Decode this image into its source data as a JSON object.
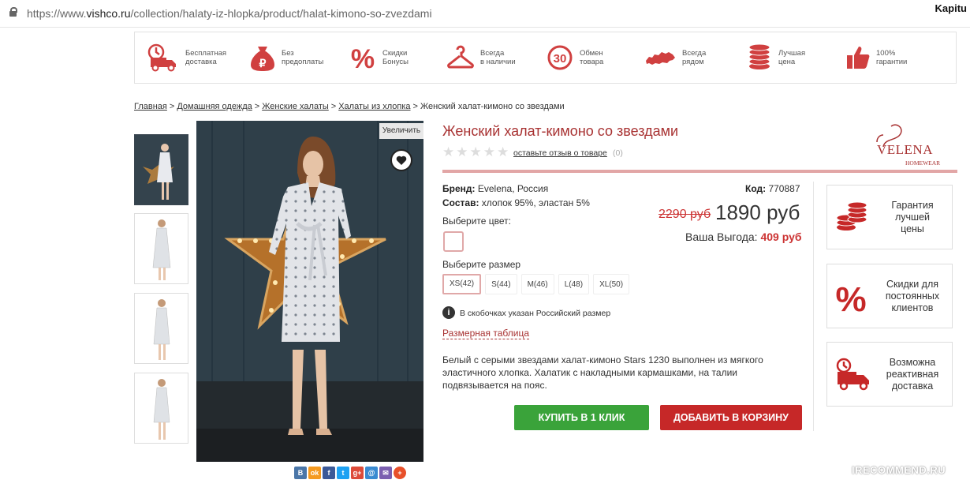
{
  "browser": {
    "url_prefix": "https://www.",
    "url_domain": "vishco.ru",
    "url_path": "/collection/halaty-iz-hlopka/product/halat-kimono-so-zvezdami",
    "top_right": "Kapitu"
  },
  "benefits": [
    {
      "icon": "delivery-truck-icon",
      "text": "Бесплатная\nдоставка"
    },
    {
      "icon": "money-bag-icon",
      "text": "Без\nпредоплаты"
    },
    {
      "icon": "percent-icon",
      "text": "Скидки\nБонусы"
    },
    {
      "icon": "hanger-icon",
      "text": "Всегда\nв наличии"
    },
    {
      "icon": "exchange-30-icon",
      "text": "Обмен\nтовара"
    },
    {
      "icon": "russia-map-icon",
      "text": "Всегда\nрядом"
    },
    {
      "icon": "coins-icon",
      "text": "Лучшая\nцена"
    },
    {
      "icon": "thumbs-up-icon",
      "text": "100%\nгарантии"
    }
  ],
  "breadcrumbs": {
    "items": [
      "Главная",
      "Домашняя одежда",
      "Женские халаты",
      "Халаты из хлопка"
    ],
    "current": "Женский халат-кимоно со звездами",
    "separator": ">"
  },
  "gallery": {
    "zoom_label": "Увеличить"
  },
  "product": {
    "title": "Женский халат-кимоно со звездами",
    "rating": 0,
    "review_link": "оставьте отзыв о товаре",
    "review_count": "(0)",
    "brand_label": "Бренд:",
    "brand_value": "Evelena, Россия",
    "composition_label": "Состав:",
    "composition_value": "хлопок 95%, эластан 5%",
    "code_label": "Код:",
    "code_value": "770887",
    "old_price": "2290 руб",
    "price": "1890 руб",
    "profit_label": "Ваша Выгода:",
    "profit_value": "409 руб",
    "color_label": "Выберите цвет:",
    "size_label": "Выберите размер",
    "sizes": [
      "XS(42)",
      "S(44)",
      "M(46)",
      "L(48)",
      "XL(50)"
    ],
    "selected_size": "XS(42)",
    "size_note": "В скобочках указан Российский размер",
    "size_table_link": "Размерная таблица",
    "description": "Белый с серыми звездами халат-кимоно Stars 1230 выполнен из мягкого эластичного хлопка. Халатик с накладными кармашками, на талии подвязывается на пояс.",
    "buy_one_click": "КУПИТЬ В 1 КЛИК",
    "add_to_cart": "ДОБАВИТЬ В КОРЗИНУ"
  },
  "brand_logo": {
    "name": "VELENA",
    "sub": "HOMEWEAR"
  },
  "side_boxes": [
    {
      "icon": "coins-icon",
      "text": "Гарантия\nлучшей\nцены"
    },
    {
      "icon": "percent-icon",
      "text": "Скидки для\nпостоянных\nклиентов"
    },
    {
      "icon": "delivery-truck-icon",
      "text": "Возможна\nреактивная\nдоставка"
    }
  ],
  "share": [
    "В",
    "ok",
    "f",
    "t",
    "g+",
    "@",
    "✉",
    "+"
  ],
  "watermark": "IRECOMMEND.RU",
  "colors": {
    "accent_red": "#c62828",
    "title_red": "#a83232",
    "buy_green": "#3aa33a"
  }
}
